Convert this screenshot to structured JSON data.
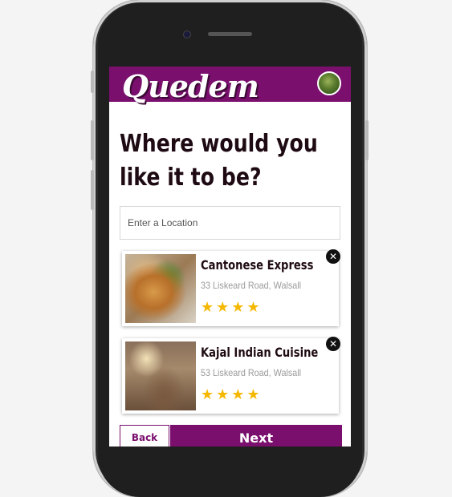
{
  "app": {
    "logo": "Quedem",
    "brand_color": "#7a0f6e"
  },
  "page": {
    "heading": "Where would you like it to be?"
  },
  "search": {
    "placeholder": "Enter a Location",
    "value": ""
  },
  "restaurants": [
    {
      "name": "Cantonese Express",
      "address": "33 Liskeard Road, Walsall",
      "rating": 4,
      "image_icon": "food-photo"
    },
    {
      "name": "Kajal Indian Cuisine",
      "address": "53 Liskeard Road, Walsall",
      "rating": 4,
      "image_icon": "restaurant-interior-photo"
    }
  ],
  "actions": {
    "back_label": "Back",
    "next_label": "Next"
  },
  "icons": {
    "close": "close-icon",
    "star": "star-icon"
  }
}
